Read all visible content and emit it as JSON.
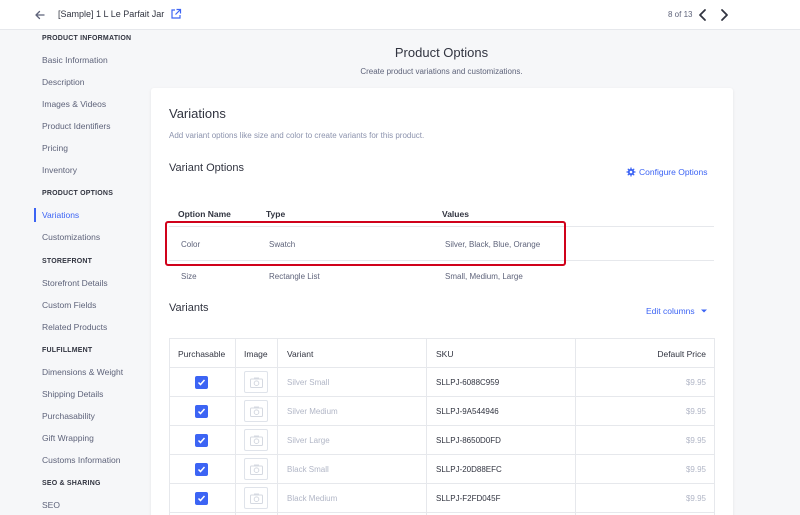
{
  "header": {
    "product_title": "[Sample] 1 L Le Parfait Jar",
    "pager": "8 of 13",
    "icons": {
      "back": "back-arrow-icon",
      "external": "external-link-icon",
      "prev": "chevron-left-icon",
      "next": "chevron-right-icon"
    }
  },
  "sidebar": {
    "sections": [
      {
        "heading": "PRODUCT INFORMATION",
        "items": [
          "Basic Information",
          "Description",
          "Images & Videos",
          "Product Identifiers",
          "Pricing",
          "Inventory"
        ]
      },
      {
        "heading": "PRODUCT OPTIONS",
        "items": [
          "Variations",
          "Customizations"
        ]
      },
      {
        "heading": "STOREFRONT",
        "items": [
          "Storefront Details",
          "Custom Fields",
          "Related Products"
        ]
      },
      {
        "heading": "FULFILLMENT",
        "items": [
          "Dimensions & Weight",
          "Shipping Details",
          "Purchasability",
          "Gift Wrapping",
          "Customs Information"
        ]
      },
      {
        "heading": "SEO & SHARING",
        "items": [
          "SEO"
        ]
      }
    ],
    "active_item": "Variations"
  },
  "page": {
    "title": "Product Options",
    "subtitle": "Create product variations and customizations."
  },
  "variations": {
    "title": "Variations",
    "description": "Add variant options like size and color to create variants for this product.",
    "variant_options_title": "Variant Options",
    "configure_label": "Configure Options",
    "columns": [
      "Option Name",
      "Type",
      "Values"
    ],
    "rows": [
      {
        "name": "Color",
        "type": "Swatch",
        "values": "Silver, Black, Blue, Orange"
      },
      {
        "name": "Size",
        "type": "Rectangle List",
        "values": "Small, Medium, Large"
      }
    ]
  },
  "variants": {
    "title": "Variants",
    "edit_columns_label": "Edit columns",
    "columns": [
      "Purchasable",
      "Image",
      "Variant",
      "SKU",
      "Default Price"
    ],
    "rows": [
      {
        "purchasable": true,
        "variant": "Silver Small",
        "sku": "SLLPJ-6088C959",
        "price": "$9.95"
      },
      {
        "purchasable": true,
        "variant": "Silver Medium",
        "sku": "SLLPJ-9A544946",
        "price": "$9.95"
      },
      {
        "purchasable": true,
        "variant": "Silver Large",
        "sku": "SLLPJ-8650D0FD",
        "price": "$9.95"
      },
      {
        "purchasable": true,
        "variant": "Black Small",
        "sku": "SLLPJ-20D88EFC",
        "price": "$9.95"
      },
      {
        "purchasable": true,
        "variant": "Black Medium",
        "sku": "SLLPJ-F2FD045F",
        "price": "$9.95"
      }
    ]
  },
  "colors": {
    "accent": "#3c64f4",
    "highlight": "#d0021b",
    "text": "#313440",
    "muted": "#5e637a",
    "faint": "#b1b6c6"
  }
}
